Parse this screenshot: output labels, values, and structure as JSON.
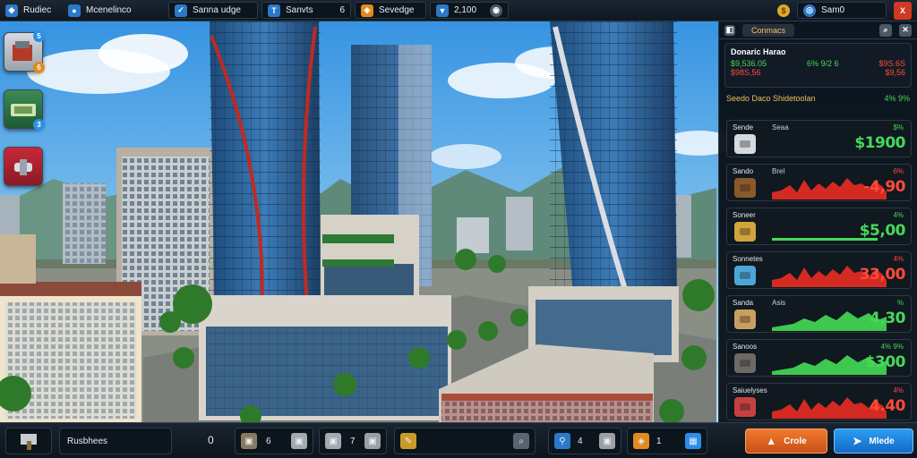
{
  "topbar": {
    "player_name": "Rudiec",
    "company_name": "Mcenelinco",
    "resource_1": "Sanna udge",
    "resource_2": "Sanvts",
    "resource_2_count": "6",
    "resource_3": "Sevedge",
    "resource_4": "2,100",
    "coins": "Sam0",
    "close_label": "X"
  },
  "slots": [
    {
      "badge_top": "5",
      "badge": "6"
    },
    {
      "badge": "3"
    },
    {}
  ],
  "panel": {
    "tab_left": "",
    "tab_active": "Conmacs",
    "summary": {
      "title": "Donaric Harao",
      "line1_left": "$9,536.05",
      "line1_mid": "6% 9/2 6",
      "line1_right": "$9S.6S",
      "line2_left": "$98S,56",
      "line2_right": "$9,56"
    },
    "section_title": "Seedo Daco Shidetoolan",
    "section_right": "4% 9%",
    "rows": [
      {
        "name": "Sende",
        "tag": "Seaa",
        "pct": "$%",
        "price": "$1900",
        "price_color": "#46d85a",
        "icon": "gear",
        "trend": "none"
      },
      {
        "name": "Sando",
        "tag": "Brel",
        "pct": "6%",
        "price": "-4,90",
        "price_color": "#ff4a3a",
        "icon": "cable",
        "trend": "down"
      },
      {
        "name": "Soneer",
        "tag": "",
        "pct": "4%",
        "price": "$5,00",
        "price_color": "#46d85a",
        "icon": "gold",
        "trend": "flat"
      },
      {
        "name": "Sonnetes",
        "tag": "",
        "pct": "4%",
        "price": "33,00",
        "price_color": "#ff4a3a",
        "icon": "pipe",
        "trend": "down"
      },
      {
        "name": "Sanda",
        "tag": "Asis",
        "pct": "%",
        "price": "4,30",
        "price_color": "#46d85a",
        "icon": "crate",
        "trend": "up"
      },
      {
        "name": "Sanoos",
        "tag": "",
        "pct": "4% 9%",
        "price": "$300",
        "price_color": "#46d85a",
        "icon": "box",
        "trend": "up"
      },
      {
        "name": "Saiuelyses",
        "tag": "",
        "pct": "4%",
        "price": "4.40",
        "price_color": "#ff4a3a",
        "icon": "chip",
        "trend": "down"
      }
    ]
  },
  "bottombar": {
    "project_name": "Rusbhees",
    "project_count": "0",
    "res_a_count": "6",
    "res_b_count": "7",
    "res_c_count": "4",
    "res_d_count": "1",
    "sell_label": "Crole",
    "buy_label": "Mlede"
  },
  "colors": {
    "accent": "#f0c05a",
    "up": "#46d85a",
    "down": "#ff4a3a",
    "sell": "#e8692a",
    "buy": "#2a8fe8"
  }
}
